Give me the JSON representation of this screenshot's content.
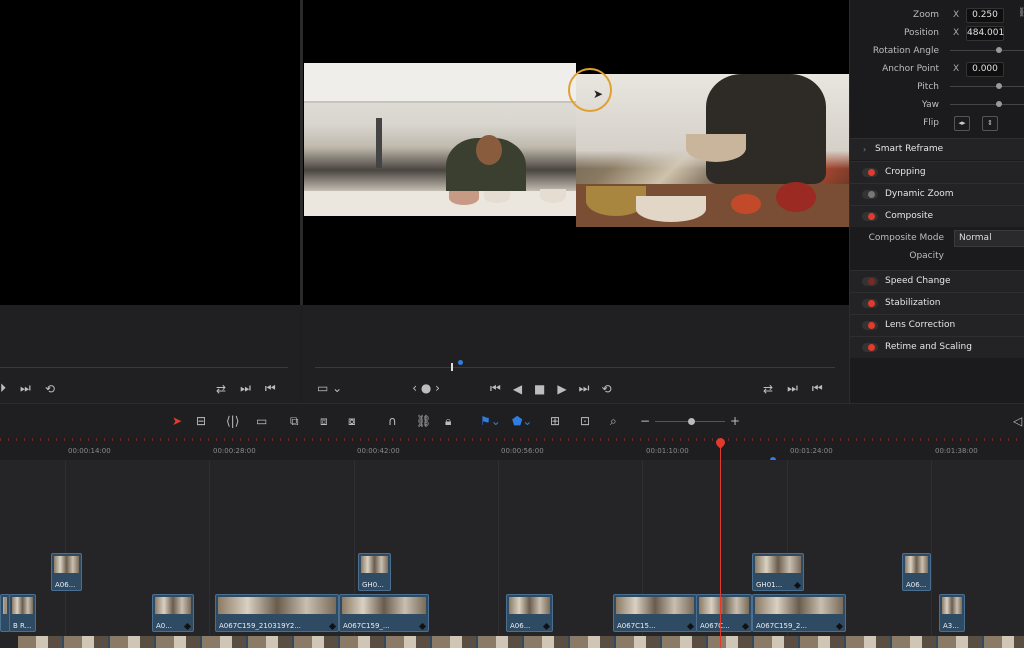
{
  "colors": {
    "accent_red": "#e23b2e",
    "accent_blue": "#2f7de1",
    "clip_blue": "#2f4a63",
    "cursor_ring": "#e0a030"
  },
  "source_viewer": {
    "controls": [
      "⏵",
      "⏭",
      "⟲"
    ],
    "right_controls": [
      "⇄",
      "⏭",
      "⏮"
    ]
  },
  "program_viewer": {
    "left_controls": [
      "▭ ⌄",
      "‹ ● ›"
    ],
    "transport": [
      "⏮",
      "◀",
      "■",
      "▶",
      "⏭",
      "⟲"
    ],
    "right_controls": [
      "⇄",
      "⏭",
      "⏮"
    ]
  },
  "inspector": {
    "zoom_label": "Zoom",
    "zoom_x": "X",
    "zoom_value": "0.250",
    "position_label": "Position",
    "position_x": "X",
    "position_value": "484.001",
    "rotation_label": "Rotation Angle",
    "anchor_label": "Anchor Point",
    "anchor_x": "X",
    "anchor_value": "0.000",
    "pitch_label": "Pitch",
    "yaw_label": "Yaw",
    "flip_label": "Flip",
    "smart_reframe": "Smart Reframe",
    "sections": [
      {
        "label": "Cropping",
        "active": true
      },
      {
        "label": "Dynamic Zoom",
        "active": false
      },
      {
        "label": "Composite",
        "active": true
      }
    ],
    "composite_mode_label": "Composite Mode",
    "composite_mode_value": "Normal",
    "opacity_label": "Opacity",
    "sections2": [
      {
        "label": "Speed Change",
        "active": false
      },
      {
        "label": "Stabilization",
        "active": true
      },
      {
        "label": "Lens Correction",
        "active": true
      },
      {
        "label": "Retime and Scaling",
        "active": true
      }
    ]
  },
  "ruler": {
    "timecodes": [
      "00:00:14:00",
      "00:00:28:00",
      "00:00:42:00",
      "00:00:56:00",
      "00:01:10:00",
      "00:01:24:00",
      "00:01:38:00"
    ]
  },
  "clips": {
    "v3": [
      {
        "label": "A06..."
      },
      {
        "label": "GH0..."
      },
      {
        "label": "GH01..."
      },
      {
        "label": "A06..."
      }
    ],
    "v2": [
      {
        "label": "B R..."
      },
      {
        "label": "A0..."
      },
      {
        "label": "A067C159_210319Y2..."
      },
      {
        "label": "A067C159_..."
      },
      {
        "label": "A06..."
      },
      {
        "label": "A067C15..."
      },
      {
        "label": "A067C..."
      },
      {
        "label": "A067C159_2..."
      },
      {
        "label": "A3..."
      }
    ]
  }
}
